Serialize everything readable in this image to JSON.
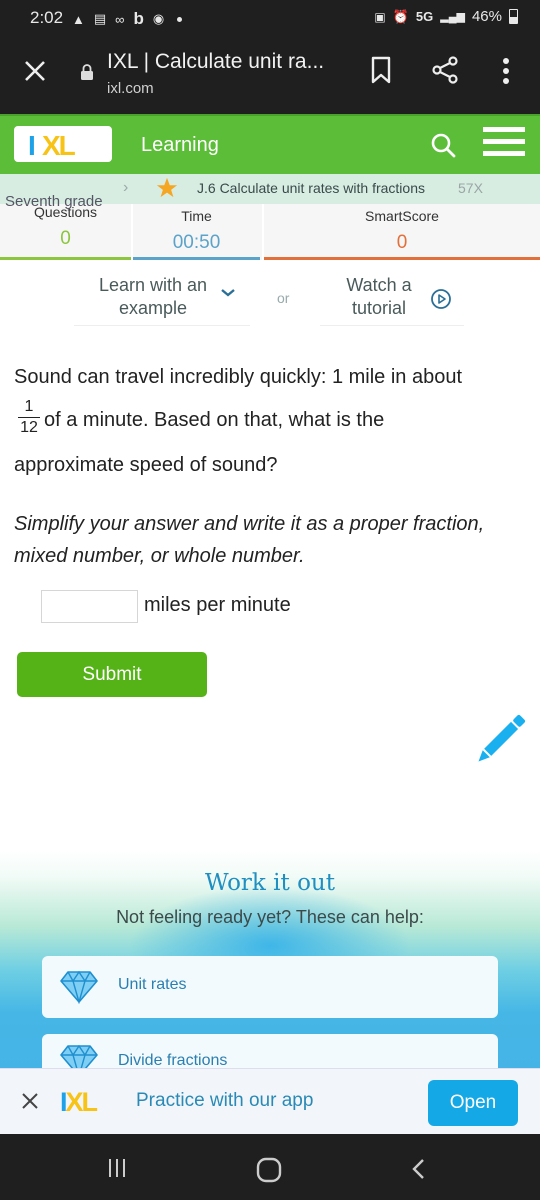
{
  "status_bar": {
    "time": "2:02",
    "network": "5G",
    "battery": "46%",
    "battery_level": 0.46,
    "left_icons": [
      "snapchat-icon",
      "news-icon",
      "voicemail-icon",
      "bing-icon",
      "chrome-icon",
      "dot-icon"
    ],
    "right_icons": [
      "vpn-icon",
      "alarm-icon",
      "signal-icon",
      "battery-icon"
    ]
  },
  "browser": {
    "page_title": "IXL | Calculate unit ra...",
    "url": "ixl.com"
  },
  "header": {
    "logo_i": "I",
    "logo_xl": "XL",
    "section": "Learning",
    "colors": {
      "bar": "#5bbd38",
      "logo_blue": "#1da1e8",
      "logo_yellow": "#f7c317"
    }
  },
  "breadcrumb": {
    "grade": "Seventh grade",
    "skill": "J.6 Calculate unit rates with fractions",
    "code": "57X"
  },
  "stats": {
    "questions": {
      "label": "Questions",
      "value": "0",
      "color": "#8cc63f"
    },
    "time": {
      "label": "Time",
      "value": "00:50",
      "color": "#5ba3c9"
    },
    "smartscore": {
      "label": "SmartScore",
      "value": "0",
      "color": "#e2703a"
    }
  },
  "help": {
    "learn_label": "Learn with an example",
    "or_label": "or",
    "watch_label": "Watch a tutorial"
  },
  "question": {
    "line1": "Sound can travel incredibly quickly: 1 mile in about",
    "fraction_num": "1",
    "fraction_den": "12",
    "line2": "of a minute. Based on that, what is the",
    "line3": "approximate speed of sound?",
    "instructions": "Simplify your answer and write it as a proper fraction, mixed number, or whole number.",
    "answer_value": "",
    "answer_unit": "miles per minute",
    "submit_label": "Submit"
  },
  "work_it_out": {
    "title": "Work it out",
    "subtitle": "Not feeling ready yet? These can help:",
    "items": [
      {
        "label": "Unit rates"
      },
      {
        "label": "Divide fractions"
      }
    ]
  },
  "app_banner": {
    "text": "Practice with our app",
    "open_label": "Open"
  }
}
